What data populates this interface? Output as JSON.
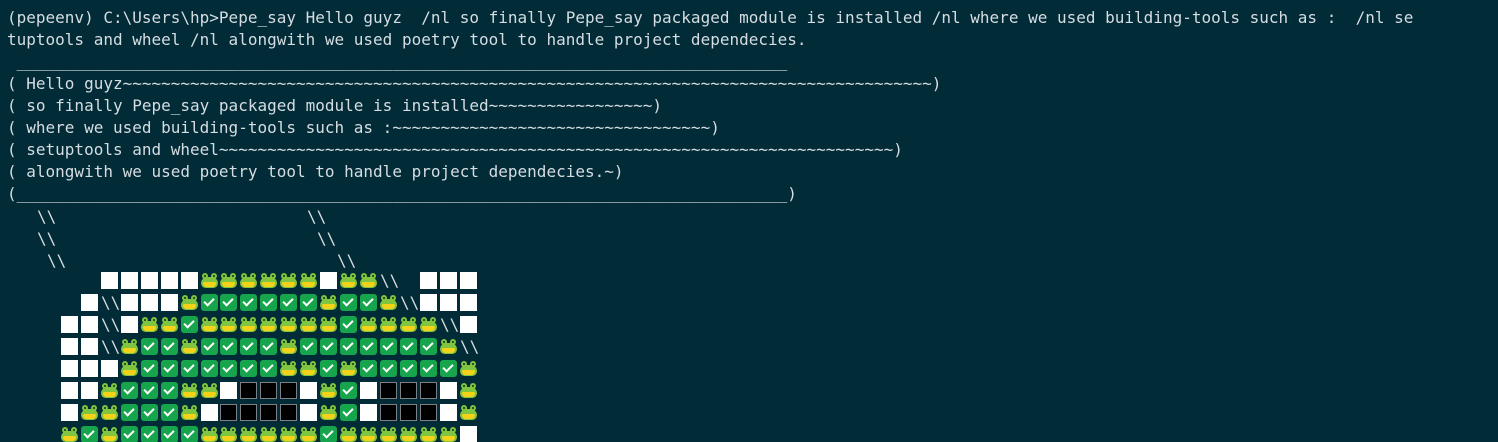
{
  "terminal": {
    "lines": [
      "(pepeenv) C:\\Users\\hp>Pepe_say Hello guyz  /nl so finally Pepe_say packaged module is installed /nl where we used building-tools such as :  /nl se",
      "tuptools and wheel /nl alongwith we used poetry tool to handle project dependecies.",
      " ________________________________________________________________________________",
      "( Hello guyz~~~~~~~~~~~~~~~~~~~~~~~~~~~~~~~~~~~~~~~~~~~~~~~~~~~~~~~~~~~~~~~~~~~~~~~~~~~~~~~~~~~~)",
      "( so finally Pepe_say packaged module is installed~~~~~~~~~~~~~~~~~)",
      "( where we used building-tools such as :~~~~~~~~~~~~~~~~~~~~~~~~~~~~~~~~~)",
      "( setuptools and wheel~~~~~~~~~~~~~~~~~~~~~~~~~~~~~~~~~~~~~~~~~~~~~~~~~~~~~~~~~~~~~~~~~~~~~~)",
      "( alongwith we used poetry tool to handle project dependecies.~)",
      "(________________________________________________________________________________)"
    ],
    "slash_glyph": "\\\\",
    "art_rows": [
      ".....wwwwwffffffwffs.www",
      "....wswwwfccccccfccfswww",
      "...wwswffcfffffffcffffsw",
      "...wwsfccfccccfcccccccfs",
      "...wwwfcccccccffcfcccccf",
      "...wwfcccffwbbbwfcwbbbwf",
      "...wffcccfwbbbbwfcwbbbwf",
      "...fcfccccffffffcffffffw"
    ],
    "legend": {
      "w": "white-square",
      "b": "black-square",
      "c": "check-mark",
      "f": "frog-face",
      "s": "backslashes"
    },
    "colors": {
      "background": "#012b36",
      "text": "#d6dde2",
      "check": "#16a54c",
      "frog": "#7fc540"
    }
  }
}
